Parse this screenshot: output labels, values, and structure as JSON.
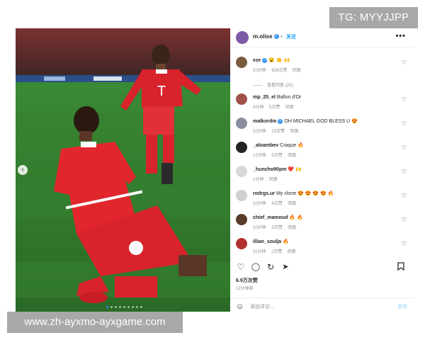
{
  "watermarks": {
    "top": "TG: MYYJJPP",
    "bottom": "www.zh-ayxmo-ayxgame.com"
  },
  "post": {
    "username": "m.olise",
    "verified_icon": "verified-badge-icon",
    "follow_label": "关注",
    "more_label": "•••",
    "carousel_prev_label": "‹",
    "carousel": {
      "count": 9,
      "active_index": 0
    },
    "likes": "6.9万次赞",
    "time_ago": "12分钟前",
    "add_comment_placeholder": "添加评论...",
    "post_button": "发布"
  },
  "comments": [
    {
      "user": "eze",
      "verified": true,
      "text": "😮 👏 🙌",
      "time": "10分钟",
      "likes": "926次赞",
      "reply": "回复",
      "avatar_color": "#7a5c3c"
    },
    {
      "user": "mp_25_el",
      "verified": false,
      "text": "Ballon d'Or",
      "time": "4分钟",
      "likes": "5次赞",
      "reply": "回复",
      "avatar_color": "#a0524a"
    },
    {
      "user": "malkordm",
      "verified": true,
      "text": "OH MICHAEL GOD BLESS U 😍",
      "time": "10分钟",
      "likes": "23次赞",
      "reply": "回复",
      "avatar_color": "#8a8fa0"
    },
    {
      "user": "_aloambev",
      "verified": false,
      "text": "Craque 🔥",
      "time": "12分钟",
      "likes": "5次赞",
      "reply": "回复",
      "avatar_color": "#222222"
    },
    {
      "user": "_huncho90pm",
      "verified": false,
      "text": "❤️ 🙌",
      "time": "1分钟",
      "likes": "",
      "reply": "回复",
      "avatar_color": "#d7d7d7"
    },
    {
      "user": "rodrgs.ur",
      "verified": false,
      "text": "My clone 😍 😍 😍 😍 🔥",
      "time": "10分钟",
      "likes": "4次赞",
      "reply": "回复",
      "avatar_color": "#d0d0d0"
    },
    {
      "user": "chief_mamoud",
      "verified": false,
      "text": "🔥 🔥",
      "time": "10分钟",
      "likes": "3次赞",
      "reply": "回复",
      "avatar_color": "#5a3b2a"
    },
    {
      "user": "illian_soulja",
      "verified": false,
      "text": "🔥",
      "time": "11分钟",
      "likes": "2次赞",
      "reply": "回复",
      "avatar_color": "#b03030"
    }
  ],
  "view_replies": "查看回复 (20)",
  "icons": {
    "heart": "♡",
    "comment": "💬",
    "repost": "↻",
    "share": "➤",
    "bookmark": "🔖",
    "emoji": "☺"
  },
  "colors": {
    "pitch": "#2f7a2a",
    "jersey": "#dc1f2a",
    "link_blue": "#0095f6"
  }
}
